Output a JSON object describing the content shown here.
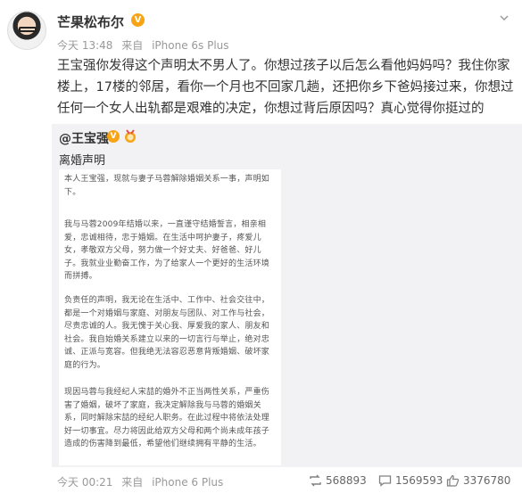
{
  "post": {
    "author": "芒果松布尔",
    "verified_badge": "V",
    "time": "今天 13:48",
    "source_prefix": "来自",
    "source": "iPhone 6s Plus",
    "text": "王宝强你发得这个声明太不男人了。你想过孩子以后怎么看他妈妈吗？我住你家楼上，17楼的邻居，看你一个月也不回家几趟，还把你乡下爸妈接过来，你想过任何一个女人出轨都是艰难的决定，你想过背后原因吗？真心觉得你挺过的"
  },
  "repost": {
    "author": "@王宝强",
    "verified_badge": "V",
    "text": "离婚声明",
    "document": {
      "para1": "本人王宝强，现就与妻子马蓉解除婚姻关系一事，声明如下。",
      "para2": "我与马蓉2009年结婚以来，一直谨守结婚誓言，相亲相爱，忠诚相待，忠于婚姻。在生活中呵护妻子，疼爱儿女，孝敬双方父母，努力做一个好丈夫、好爸爸、好儿子。我就业业勤奋工作，为了给家人一个更好的生活环境而拼搏。",
      "para3": "负责任的声明，我无论在生活中、工作中、社会交往中，都是一个对婚姻与家庭、对朋友与团队、对工作与社会，尽责忠诚的人。我无愧于关心我、厚爱我的家人、朋友和社会。我自始婚关系建立以来的一切言行与举止，绝对忠诚、正派与宽容。但我绝无法容忍恶意背叛婚姻、破坏家庭的行为。",
      "para4": "现因马蓉与我经纪人宋喆的婚外不正当两性关系，严重伤害了婚姻，破坏了家庭，我决定解除我与马蓉的婚姻关系，同时解除宋喆的经纪人职务。在此过程中将依法处理好一切事宜。尽力将因此给双方父母和两个尚未成年孩子造成的伤害降到最低，希望他们继续拥有平静的生活。"
    },
    "time": "今天 00:21",
    "source_prefix": "来自",
    "source": "iPhone 6 Plus"
  },
  "stats": {
    "reposts": "568893",
    "comments": "1569593",
    "likes": "3376780"
  },
  "colors": {
    "badge_orange": "#f7a416",
    "repost_bg": "#f2f2f5",
    "meta_gray": "#999999"
  }
}
